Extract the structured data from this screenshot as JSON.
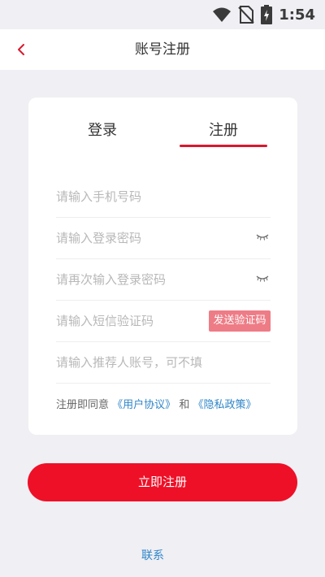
{
  "status_bar": {
    "time": "1:54",
    "icons": [
      "wifi-icon",
      "no-sim-icon",
      "battery-charging-icon"
    ]
  },
  "header": {
    "back_icon": "chevron-left-icon",
    "title": "账号注册",
    "back_color": "#d9182d"
  },
  "tabs": [
    {
      "label": "登录",
      "active": false
    },
    {
      "label": "注册",
      "active": true
    }
  ],
  "form": {
    "phone_placeholder": "请输入手机号码",
    "password_placeholder": "请输入登录密码",
    "confirm_password_placeholder": "请再次输入登录密码",
    "sms_code_placeholder": "请输入短信验证码",
    "send_code_label": "发送验证码",
    "referrer_placeholder": "请输入推荐人账号，可不填",
    "eye_icon": "eye-closed-icon"
  },
  "agreement": {
    "prefix": "注册即同意",
    "user_agreement": "《用户协议》",
    "and": "和",
    "privacy_policy": "《隐私政策》"
  },
  "submit_label": "立即注册",
  "footer": {
    "contact_label": "联系"
  },
  "colors": {
    "accent": "#ee1027",
    "link": "#2f86c9",
    "send_code_bg": "#ee7c86",
    "background": "#efeff4"
  }
}
